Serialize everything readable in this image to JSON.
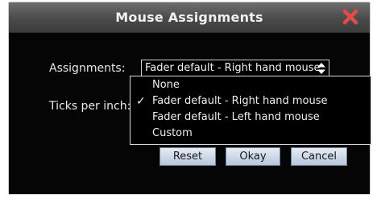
{
  "dialog": {
    "title": "Mouse Assignments",
    "close_icon": "close-x-icon",
    "accent_close_color": "#e64a4a"
  },
  "form": {
    "assignments_label": "Assignments:",
    "assignments_value": "Fader default - Right hand mouse",
    "ticks_label": "Ticks per inch:"
  },
  "dropdown": {
    "options": [
      {
        "label": "None",
        "checked": false
      },
      {
        "label": "Fader default - Right hand mouse",
        "checked": true
      },
      {
        "label": "Fader default - Left hand mouse",
        "checked": false
      },
      {
        "label": "Custom",
        "checked": false
      }
    ],
    "check_glyph": "✓"
  },
  "buttons": {
    "reset": "Reset",
    "okay": "Okay",
    "cancel": "Cancel"
  }
}
